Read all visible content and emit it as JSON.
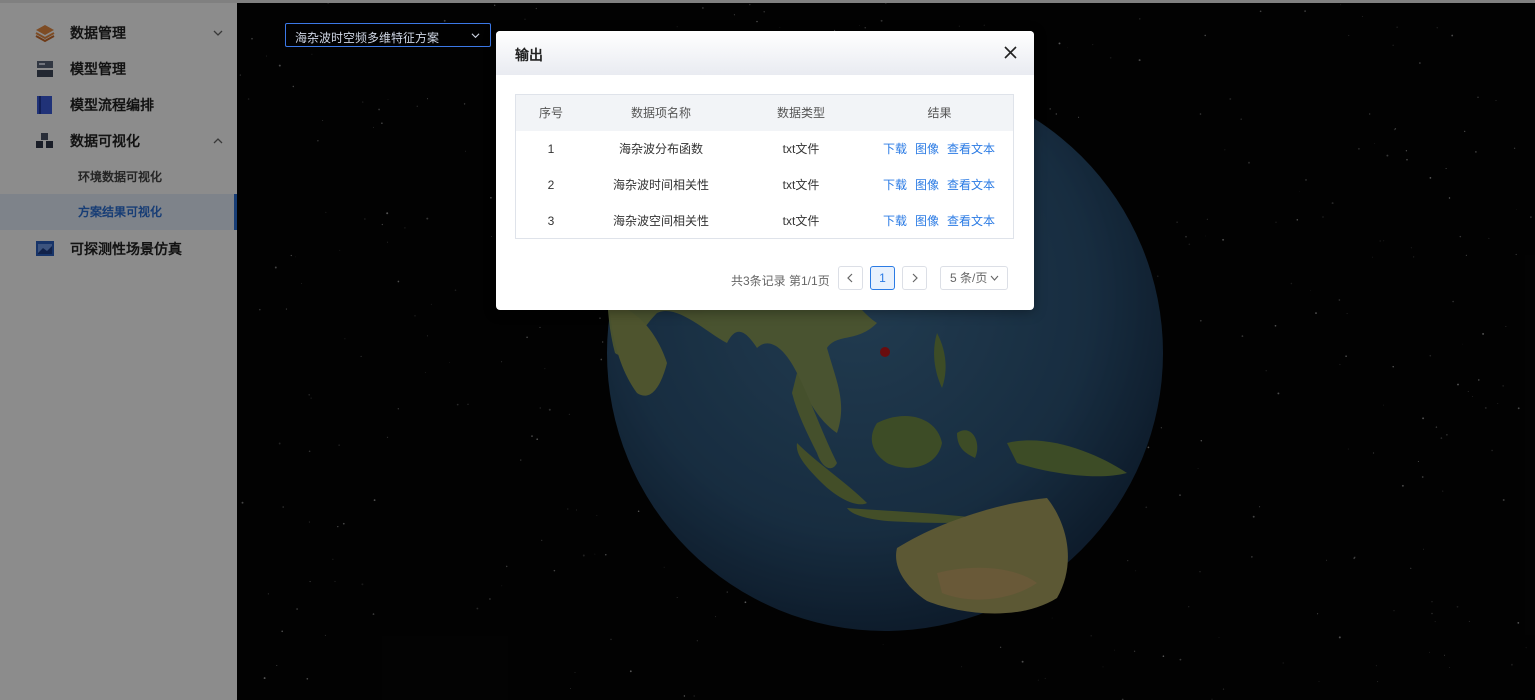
{
  "sidebar": {
    "items": [
      {
        "label": "数据管理",
        "icon": "layers-icon",
        "expandable": true,
        "expanded": false
      },
      {
        "label": "模型管理",
        "icon": "server-icon"
      },
      {
        "label": "模型流程编排",
        "icon": "book-icon"
      },
      {
        "label": "数据可视化",
        "icon": "cubes-icon",
        "expandable": true,
        "expanded": true
      },
      {
        "label": "可探测性场景仿真",
        "icon": "screen-icon"
      }
    ],
    "sub_items": [
      {
        "label": "环境数据可视化",
        "active": false
      },
      {
        "label": "方案结果可视化",
        "active": true
      }
    ]
  },
  "scheme_select": {
    "value": "海杂波时空频多维特征方案"
  },
  "dialog": {
    "title": "输出",
    "columns": [
      "序号",
      "数据项名称",
      "数据类型",
      "结果"
    ],
    "rows": [
      {
        "index": "1",
        "name": "海杂波分布函数",
        "type": "txt文件",
        "actions": [
          "下载",
          "图像",
          "查看文本"
        ]
      },
      {
        "index": "2",
        "name": "海杂波时间相关性",
        "type": "txt文件",
        "actions": [
          "下载",
          "图像",
          "查看文本"
        ]
      },
      {
        "index": "3",
        "name": "海杂波空间相关性",
        "type": "txt文件",
        "actions": [
          "下载",
          "图像",
          "查看文本"
        ]
      }
    ],
    "pagination": {
      "summary": "共3条记录 第1/1页",
      "current_page": "1",
      "page_size": "5 条/页"
    }
  },
  "colors": {
    "accent": "#2b7be4",
    "marker": "#c0161b"
  }
}
